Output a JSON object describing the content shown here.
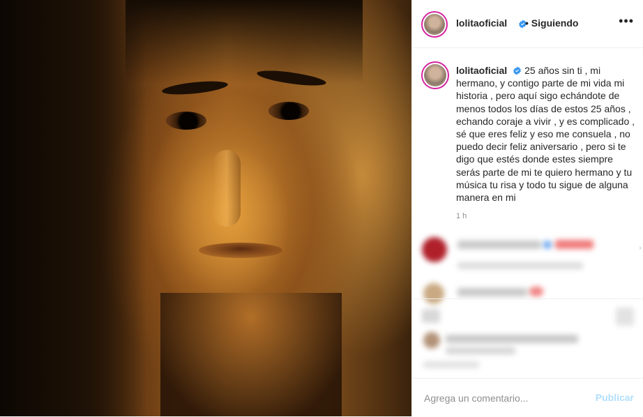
{
  "post": {
    "username": "lolitaoficial",
    "follow_status": "Siguiendo",
    "more_icon": "more-horizontal-icon",
    "verified_icon": "verified-badge-icon",
    "caption_text": "25 años sin ti , mi hermano, y contigo parte de mi vida mi historia , pero aquí sigo echándote de menos todos los días de estos 25 años , echando coraje a vivir , y es complicado , sé que eres feliz y eso me consuela , no puedo decir feliz aniversario , pero si te digo que estés donde estes siempre serás parte de mi te quiero hermano y tu música tu risa y todo tu sigue de alguna manera en mi",
    "time_ago": "1 h"
  },
  "footer": {
    "comment_placeholder": "Agrega un comentario...",
    "publish_label": "Publicar"
  },
  "colors": {
    "verified": "#3897f0",
    "publish_disabled": "#b2dffc",
    "story_ring": "#d6249f"
  }
}
